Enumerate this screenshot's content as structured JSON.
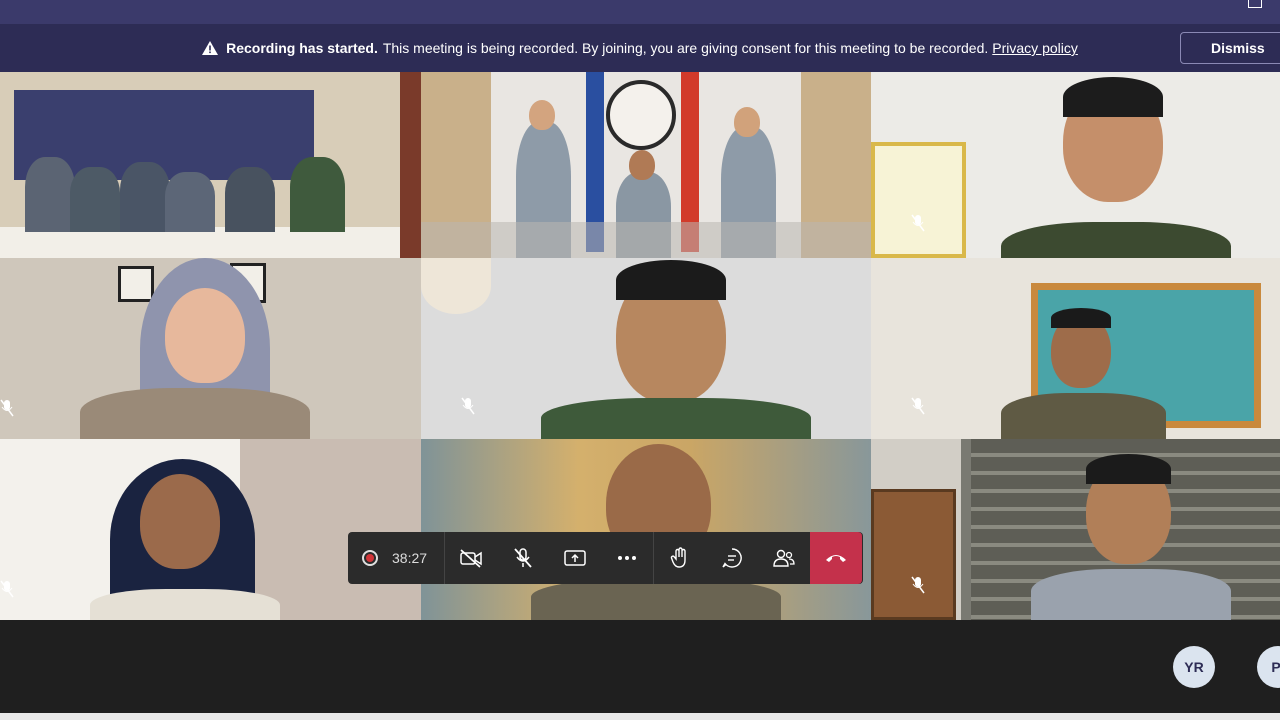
{
  "banner": {
    "bold": "Recording has started.",
    "message": "This meeting is being recorded. By joining, you are giving consent for this meeting to be recorded.",
    "link": "Privacy policy",
    "dismiss": "Dismiss"
  },
  "controls": {
    "elapsed": "38:27"
  },
  "participants_avatars": [
    {
      "initials": "YR"
    },
    {
      "initials": "PI"
    }
  ],
  "colors": {
    "banner_bg": "#2d2c55",
    "topbar_bg": "#3b3a6b",
    "hangup": "#c4314b",
    "recording_dot": "#d13438"
  }
}
